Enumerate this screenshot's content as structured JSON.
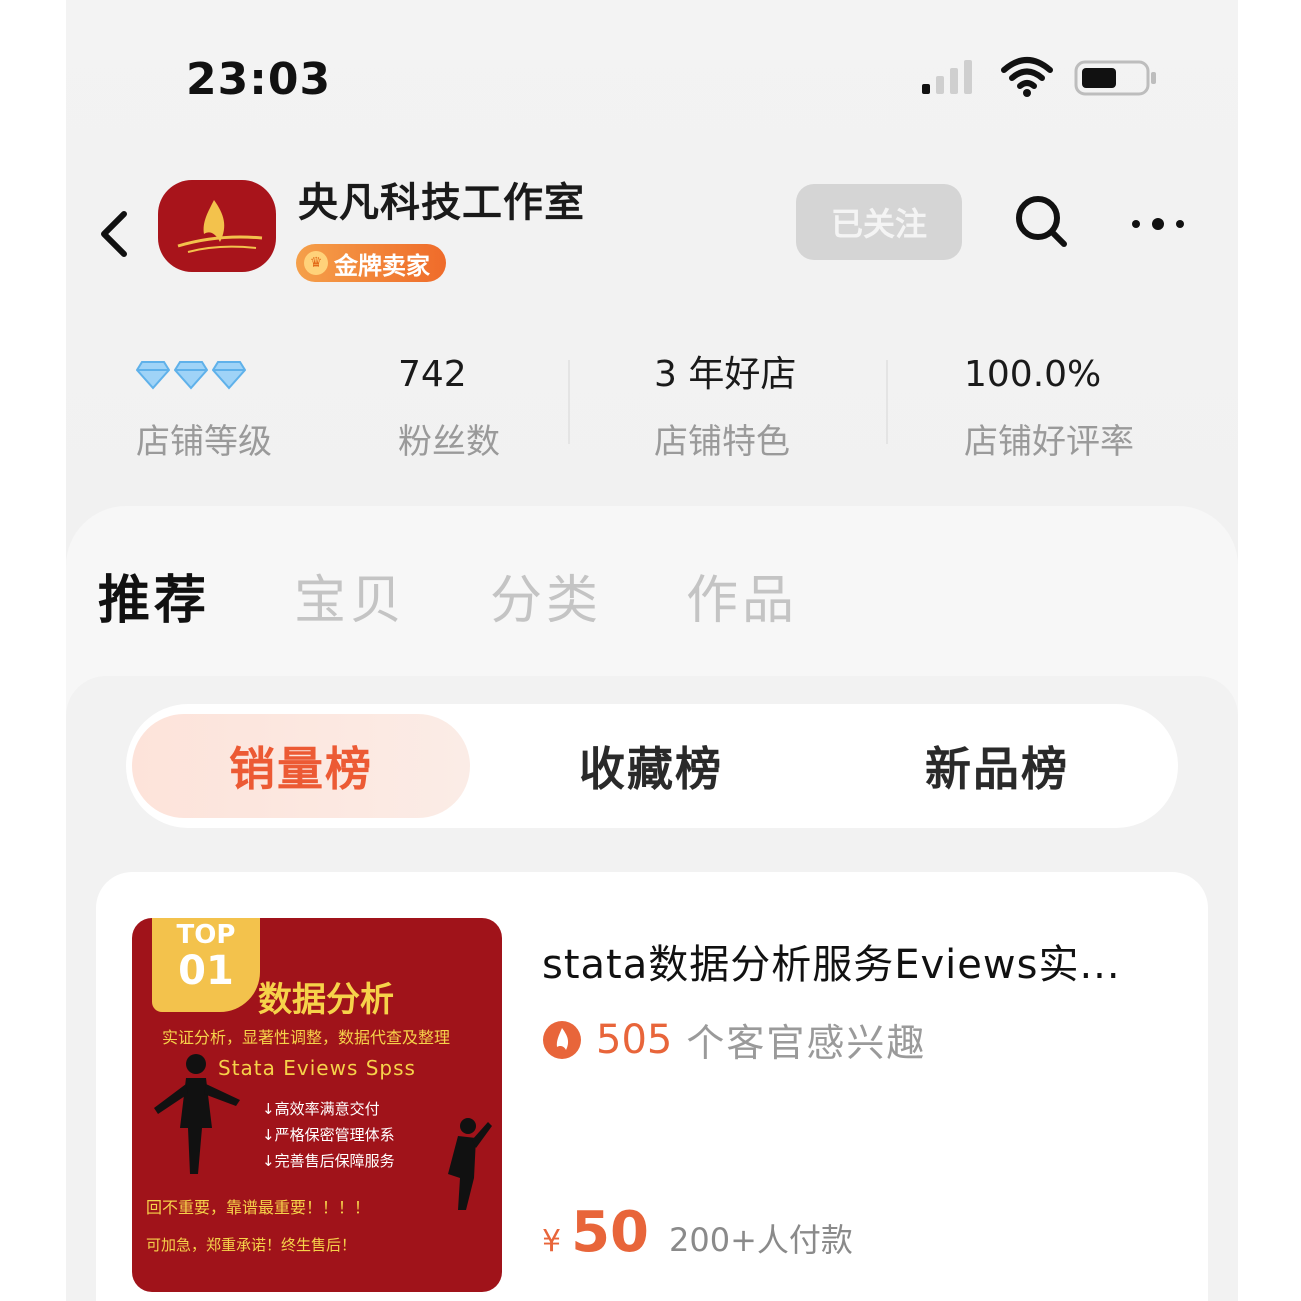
{
  "status_bar": {
    "time": "23:03"
  },
  "shop": {
    "name": "央凡科技工作室",
    "badge": "金牌卖家",
    "follow_label": "已关注"
  },
  "stats": {
    "level_label": "店铺等级",
    "level_diamonds": 3,
    "fans_value": "742",
    "fans_label": "粉丝数",
    "feature_value": "3 年好店",
    "feature_label": "店铺特色",
    "rate_value": "100.0%",
    "rate_label": "店铺好评率"
  },
  "tabs": [
    {
      "label": "推荐",
      "active": true
    },
    {
      "label": "宝贝",
      "active": false
    },
    {
      "label": "分类",
      "active": false
    },
    {
      "label": "作品",
      "active": false
    }
  ],
  "rank_tabs": [
    {
      "label": "销量榜",
      "active": true
    },
    {
      "label": "收藏榜",
      "active": false
    },
    {
      "label": "新品榜",
      "active": false
    }
  ],
  "product": {
    "rank_top": "TOP",
    "rank_num": "01",
    "image_title": "数据分析",
    "image_lines": [
      "实证分析，显著性调整，数据代查及整理",
      "Stata Eviews Spss",
      "↓高效率满意交付",
      "↓严格保密管理体系",
      "↓完善售后保障服务",
      "回不重要，靠谱最重要！！！！",
      "可加急，郑重承诺！终生售后！"
    ],
    "title": "stata数据分析服务Eviews实...",
    "interest_count": "505",
    "interest_text": "个客官感兴趣",
    "price_symbol": "¥",
    "price": "50",
    "sold": "200+人付款"
  },
  "colors": {
    "accent": "#e8653a",
    "brand_red": "#a0131a",
    "gold": "#f3c24c"
  }
}
